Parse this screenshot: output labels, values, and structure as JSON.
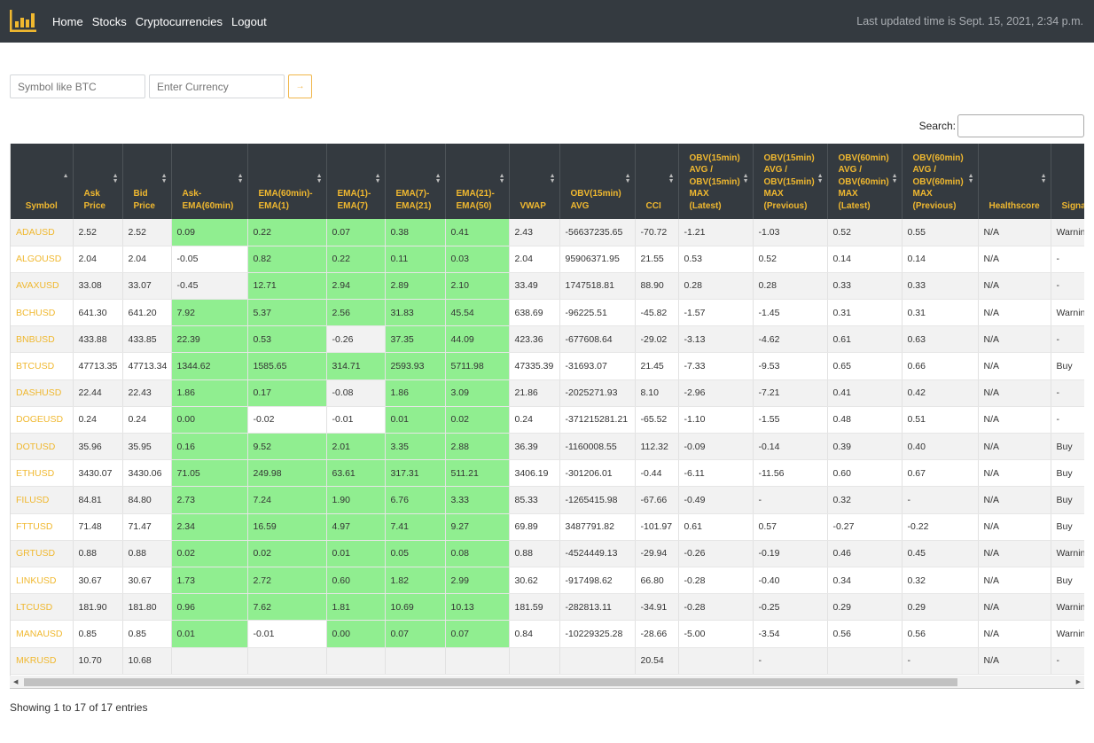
{
  "navbar": {
    "links": [
      "Home",
      "Stocks",
      "Cryptocurrencies",
      "Logout"
    ],
    "last_updated": "Last updated time is Sept. 15, 2021, 2:34 p.m."
  },
  "form": {
    "symbol_placeholder": "Symbol like BTC",
    "currency_placeholder": "Enter Currency",
    "go_label": "→"
  },
  "search": {
    "label": "Search:"
  },
  "colors": {
    "navbar": "#343a40",
    "header_text": "#f0b82f",
    "highlight_green": "#90ee90"
  },
  "table": {
    "columns": [
      [
        "Symbol"
      ],
      [
        "Ask",
        "Price"
      ],
      [
        "Bid",
        "Price"
      ],
      [
        "Ask-",
        "EMA(60min)"
      ],
      [
        "EMA(60min)-",
        "EMA(1)"
      ],
      [
        "EMA(1)-",
        "EMA(7)"
      ],
      [
        "EMA(7)-",
        "EMA(21)"
      ],
      [
        "EMA(21)-",
        "EMA(50)"
      ],
      [
        "VWAP"
      ],
      [
        "OBV(15min)",
        "AVG"
      ],
      [
        "CCI"
      ],
      [
        "OBV(15min)",
        "AVG /",
        "OBV(15min)",
        "MAX",
        "(Latest)"
      ],
      [
        "OBV(15min)",
        "AVG /",
        "OBV(15min)",
        "MAX",
        "(Previous)"
      ],
      [
        "OBV(60min)",
        "AVG /",
        "OBV(60min)",
        "MAX",
        "(Latest)"
      ],
      [
        "OBV(60min)",
        "AVG /",
        "OBV(60min)",
        "MAX",
        "(Previous)"
      ],
      [
        "Healthscore"
      ],
      [
        "Signal"
      ]
    ],
    "rows": [
      {
        "cells": [
          "ADAUSD",
          "2.52",
          "2.52",
          "0.09",
          "0.22",
          "0.07",
          "0.38",
          "0.41",
          "2.43",
          "-56637235.65",
          "-70.72",
          "-1.21",
          "-1.03",
          "0.52",
          "0.55",
          "N/A",
          "Warning"
        ],
        "green": [
          3,
          4,
          5,
          6,
          7
        ]
      },
      {
        "cells": [
          "ALGOUSD",
          "2.04",
          "2.04",
          "-0.05",
          "0.82",
          "0.22",
          "0.11",
          "0.03",
          "2.04",
          "95906371.95",
          "21.55",
          "0.53",
          "0.52",
          "0.14",
          "0.14",
          "N/A",
          "-"
        ],
        "green": [
          4,
          5,
          6,
          7
        ]
      },
      {
        "cells": [
          "AVAXUSD",
          "33.08",
          "33.07",
          "-0.45",
          "12.71",
          "2.94",
          "2.89",
          "2.10",
          "33.49",
          "1747518.81",
          "88.90",
          "0.28",
          "0.28",
          "0.33",
          "0.33",
          "N/A",
          "-"
        ],
        "green": [
          4,
          5,
          6,
          7
        ]
      },
      {
        "cells": [
          "BCHUSD",
          "641.30",
          "641.20",
          "7.92",
          "5.37",
          "2.56",
          "31.83",
          "45.54",
          "638.69",
          "-96225.51",
          "-45.82",
          "-1.57",
          "-1.45",
          "0.31",
          "0.31",
          "N/A",
          "Warning"
        ],
        "green": [
          3,
          4,
          5,
          6,
          7
        ]
      },
      {
        "cells": [
          "BNBUSD",
          "433.88",
          "433.85",
          "22.39",
          "0.53",
          "-0.26",
          "37.35",
          "44.09",
          "423.36",
          "-677608.64",
          "-29.02",
          "-3.13",
          "-4.62",
          "0.61",
          "0.63",
          "N/A",
          "-"
        ],
        "green": [
          3,
          4,
          6,
          7
        ]
      },
      {
        "cells": [
          "BTCUSD",
          "47713.35",
          "47713.34",
          "1344.62",
          "1585.65",
          "314.71",
          "2593.93",
          "5711.98",
          "47335.39",
          "-31693.07",
          "21.45",
          "-7.33",
          "-9.53",
          "0.65",
          "0.66",
          "N/A",
          "Buy"
        ],
        "green": [
          3,
          4,
          5,
          6,
          7
        ]
      },
      {
        "cells": [
          "DASHUSD",
          "22.44",
          "22.43",
          "1.86",
          "0.17",
          "-0.08",
          "1.86",
          "3.09",
          "21.86",
          "-2025271.93",
          "8.10",
          "-2.96",
          "-7.21",
          "0.41",
          "0.42",
          "N/A",
          "-"
        ],
        "green": [
          3,
          4,
          6,
          7
        ]
      },
      {
        "cells": [
          "DOGEUSD",
          "0.24",
          "0.24",
          "0.00",
          "-0.02",
          "-0.01",
          "0.01",
          "0.02",
          "0.24",
          "-371215281.21",
          "-65.52",
          "-1.10",
          "-1.55",
          "0.48",
          "0.51",
          "N/A",
          "-"
        ],
        "green": [
          3,
          6,
          7
        ]
      },
      {
        "cells": [
          "DOTUSD",
          "35.96",
          "35.95",
          "0.16",
          "9.52",
          "2.01",
          "3.35",
          "2.88",
          "36.39",
          "-1160008.55",
          "112.32",
          "-0.09",
          "-0.14",
          "0.39",
          "0.40",
          "N/A",
          "Buy"
        ],
        "green": [
          3,
          4,
          5,
          6,
          7
        ]
      },
      {
        "cells": [
          "ETHUSD",
          "3430.07",
          "3430.06",
          "71.05",
          "249.98",
          "63.61",
          "317.31",
          "511.21",
          "3406.19",
          "-301206.01",
          "-0.44",
          "-6.11",
          "-11.56",
          "0.60",
          "0.67",
          "N/A",
          "Buy"
        ],
        "green": [
          3,
          4,
          5,
          6,
          7
        ]
      },
      {
        "cells": [
          "FILUSD",
          "84.81",
          "84.80",
          "2.73",
          "7.24",
          "1.90",
          "6.76",
          "3.33",
          "85.33",
          "-1265415.98",
          "-67.66",
          "-0.49",
          "-",
          "0.32",
          "-",
          "N/A",
          "Buy"
        ],
        "green": [
          3,
          4,
          5,
          6,
          7
        ]
      },
      {
        "cells": [
          "FTTUSD",
          "71.48",
          "71.47",
          "2.34",
          "16.59",
          "4.97",
          "7.41",
          "9.27",
          "69.89",
          "3487791.82",
          "-101.97",
          "0.61",
          "0.57",
          "-0.27",
          "-0.22",
          "N/A",
          "Buy"
        ],
        "green": [
          3,
          4,
          5,
          6,
          7
        ]
      },
      {
        "cells": [
          "GRTUSD",
          "0.88",
          "0.88",
          "0.02",
          "0.02",
          "0.01",
          "0.05",
          "0.08",
          "0.88",
          "-4524449.13",
          "-29.94",
          "-0.26",
          "-0.19",
          "0.46",
          "0.45",
          "N/A",
          "Warning"
        ],
        "green": [
          3,
          4,
          5,
          6,
          7
        ]
      },
      {
        "cells": [
          "LINKUSD",
          "30.67",
          "30.67",
          "1.73",
          "2.72",
          "0.60",
          "1.82",
          "2.99",
          "30.62",
          "-917498.62",
          "66.80",
          "-0.28",
          "-0.40",
          "0.34",
          "0.32",
          "N/A",
          "Buy"
        ],
        "green": [
          3,
          4,
          5,
          6,
          7
        ]
      },
      {
        "cells": [
          "LTCUSD",
          "181.90",
          "181.80",
          "0.96",
          "7.62",
          "1.81",
          "10.69",
          "10.13",
          "181.59",
          "-282813.11",
          "-34.91",
          "-0.28",
          "-0.25",
          "0.29",
          "0.29",
          "N/A",
          "Warning"
        ],
        "green": [
          3,
          4,
          5,
          6,
          7
        ]
      },
      {
        "cells": [
          "MANAUSD",
          "0.85",
          "0.85",
          "0.01",
          "-0.01",
          "0.00",
          "0.07",
          "0.07",
          "0.84",
          "-10229325.28",
          "-28.66",
          "-5.00",
          "-3.54",
          "0.56",
          "0.56",
          "N/A",
          "Warning"
        ],
        "green": [
          3,
          5,
          6,
          7
        ]
      },
      {
        "cells": [
          "MKRUSD",
          "10.70",
          "10.68",
          "",
          "",
          "",
          "",
          "",
          "",
          "",
          "20.54",
          "",
          "-",
          "",
          "-",
          "N/A",
          "-"
        ],
        "green": []
      }
    ]
  },
  "info": "Showing 1 to 17 of 17 entries"
}
